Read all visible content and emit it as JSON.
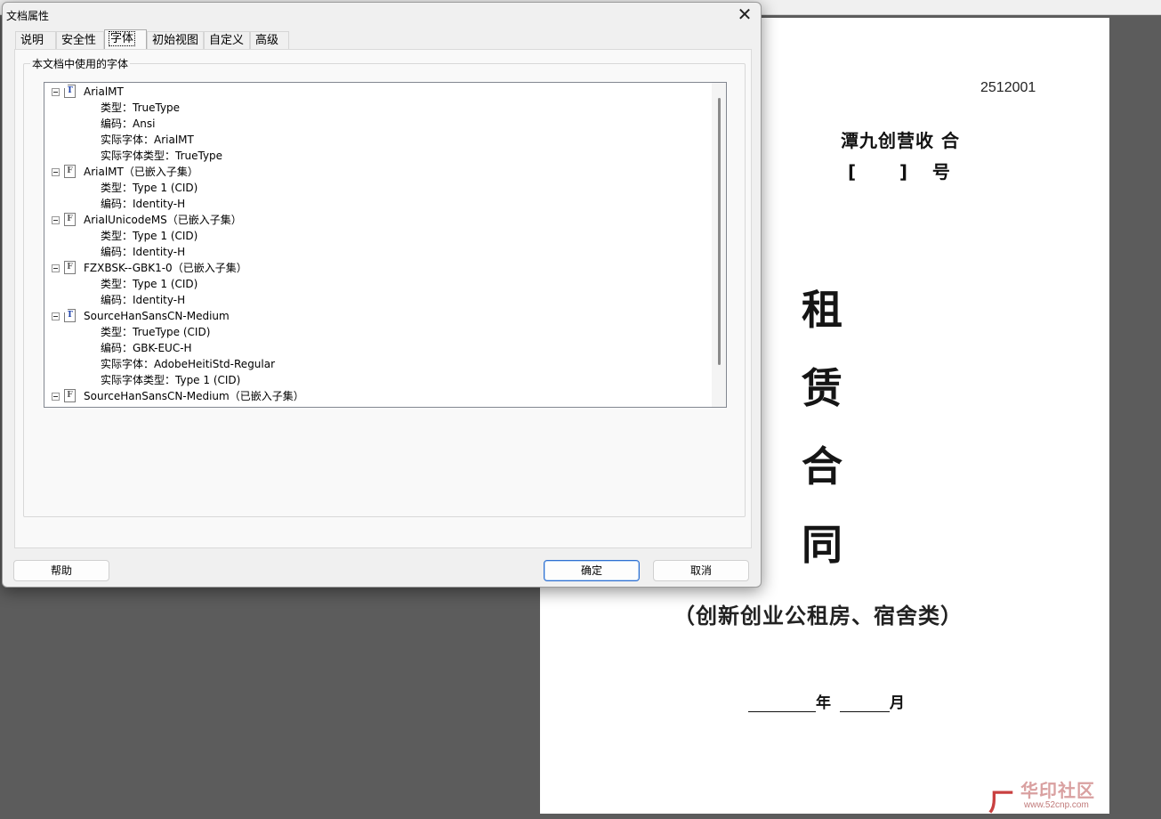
{
  "dialog": {
    "title": "文档属性",
    "close_glyph": "✕",
    "tabs": [
      {
        "label": "说明"
      },
      {
        "label": "安全性"
      },
      {
        "label": "字体"
      },
      {
        "label": "初始视图"
      },
      {
        "label": "自定义"
      },
      {
        "label": "高级"
      }
    ],
    "active_tab": "字体",
    "group_label": "本文档中使用的字体",
    "fonts": [
      {
        "name": "ArialMT",
        "icon": "truetype-font-icon",
        "props": [
          "类型：TrueType",
          "编码：Ansi",
          "实际字体：ArialMT",
          "实际字体类型：TrueType"
        ]
      },
      {
        "name": "ArialMT（已嵌入子集）",
        "icon": "embedded-font-icon",
        "props": [
          "类型：Type 1 (CID)",
          "编码：Identity-H"
        ]
      },
      {
        "name": "ArialUnicodeMS（已嵌入子集）",
        "icon": "embedded-font-icon",
        "props": [
          "类型：Type 1 (CID)",
          "编码：Identity-H"
        ]
      },
      {
        "name": "FZXBSK--GBK1-0（已嵌入子集）",
        "icon": "embedded-font-icon",
        "props": [
          "类型：Type 1 (CID)",
          "编码：Identity-H"
        ]
      },
      {
        "name": "SourceHanSansCN-Medium",
        "icon": "truetype-font-icon",
        "props": [
          "类型：TrueType (CID)",
          "编码：GBK-EUC-H",
          "实际字体：AdobeHeitiStd-Regular",
          "实际字体类型：Type 1 (CID)"
        ]
      },
      {
        "name": "SourceHanSansCN-Medium（已嵌入子集）",
        "icon": "embedded-font-icon",
        "props": []
      }
    ],
    "buttons": {
      "help": "帮助",
      "ok": "确定",
      "cancel": "取消"
    }
  },
  "document": {
    "number": "2512001",
    "line1": "潭九创营收 合",
    "line2": "[       ]    号",
    "title_chars": [
      "租",
      "赁",
      "合",
      "同"
    ],
    "subtitle": "（创新创业公租房、宿舍类）",
    "date_year": "年",
    "date_month": "月"
  },
  "watermark": {
    "logo": "ㄏ",
    "text": "华印社区",
    "url": "www.52cnp.com"
  }
}
